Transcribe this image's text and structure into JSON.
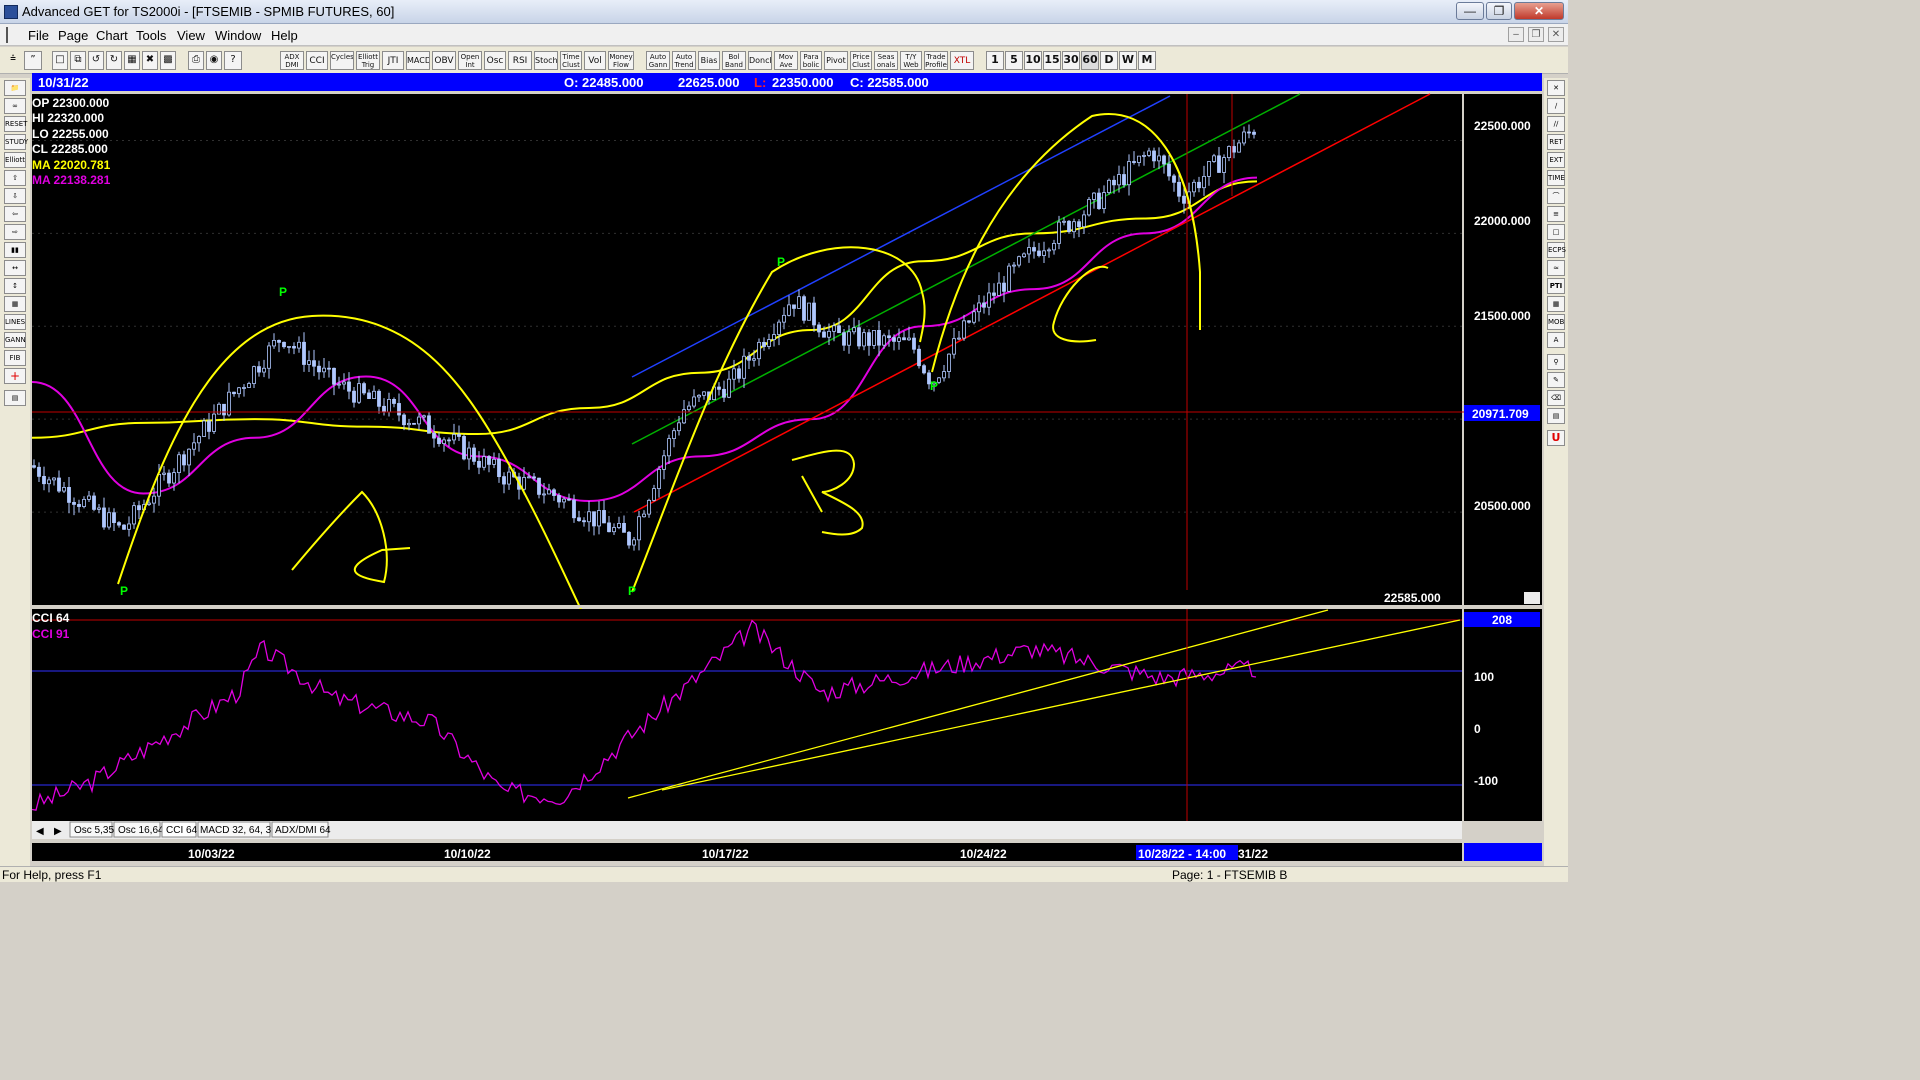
{
  "window": {
    "title": "Advanced GET for TS2000i - [FTSEMIB - SPMIB FUTURES, 60]"
  },
  "menu": [
    "File",
    "Page",
    "Chart",
    "Tools",
    "View",
    "Window",
    "Help"
  ],
  "toolbar": {
    "studies": [
      "ADX DMI",
      "CCI",
      "Cycles",
      "Elliott Trig",
      "JTI",
      "MACD",
      "OBV",
      "Open Int",
      "Osc",
      "RSI",
      "Stoch",
      "Time Clust",
      "Vol",
      "Money Flow",
      "Auto Gann",
      "Auto Trend",
      "Bias",
      "Bol Band",
      "Donch",
      "Mov Ave",
      "Para bolic",
      "Pivot",
      "Price Clust",
      "Seas onals",
      "T/Y Web",
      "Trade Profile",
      "XTL"
    ],
    "timeframes": [
      "1",
      "5",
      "10",
      "15",
      "30",
      "60",
      "D",
      "W",
      "M"
    ]
  },
  "header": {
    "date": "10/31/22",
    "open": "O: 22485.000",
    "high": "22625.000",
    "low_label": "L:",
    "low": "22350.000",
    "close": "C: 22585.000"
  },
  "readout": {
    "op": "OP  22300.000",
    "hi": "HI   22320.000",
    "lo": "LO  22255.000",
    "cl": "CL  22285.000",
    "ma1": "MA  22020.781",
    "ma2": "MA  22138.281"
  },
  "colors": {
    "bg": "#000000",
    "candle": "#b0c8ff",
    "ma1": "#ffff00",
    "ma2": "#e000e0",
    "green": "#00ff00",
    "blue": "#2040ff",
    "red": "#ff0000",
    "header_bg": "#0000ff",
    "cci": "#e000e0",
    "annot": "#ffff00"
  },
  "price_axis": {
    "ticks": [
      "22500.000",
      "22000.000",
      "21500.000",
      "20500.000"
    ],
    "cursor_label": "20971.709",
    "last_price": "22585.000"
  },
  "pivots": [
    "P",
    "P",
    "P",
    "P",
    "P"
  ],
  "annotations": {
    "a": "A",
    "b": "B",
    "c": "C"
  },
  "cci": {
    "label1": "CCI 64",
    "label2": "CCI  91",
    "ticks": [
      "100",
      "0",
      "-100"
    ],
    "value_label": "208"
  },
  "tabs": [
    "Osc 5,35",
    "Osc 16,64",
    "CCI 64",
    "MACD 32, 64, 32",
    "ADX/DMI 64"
  ],
  "time_axis": {
    "labels": [
      "10/03/22",
      "10/10/22",
      "10/17/22",
      "10/24/22"
    ],
    "cursor_label": "10/28/22 - 14:00",
    "trailing": "31/22"
  },
  "status": {
    "left": "For Help, press F1",
    "right": "Page: 1 - FTSEMIB B"
  },
  "chart_data": {
    "type": "candlestick",
    "x_labels": [
      "10/03/22",
      "10/10/22",
      "10/17/22",
      "10/24/22"
    ],
    "ylim": [
      20000,
      22750
    ],
    "y_ticks": [
      20500,
      21000,
      21500,
      22000,
      22500
    ],
    "series": [
      {
        "name": "MA",
        "values": [
          20900,
          20980,
          21000,
          20960,
          20920,
          21060,
          21250,
          21480,
          21850,
          22000,
          22080,
          22280
        ]
      },
      {
        "name": "MA",
        "values": [
          21200,
          20600,
          20900,
          21230,
          20800,
          20560,
          20800,
          21000,
          21500,
          21700,
          22000,
          22300
        ]
      }
    ],
    "cci": {
      "ylim": [
        -200,
        230
      ],
      "values": [
        -170,
        -120,
        60,
        150,
        50,
        0,
        -140,
        -150,
        190,
        60,
        150,
        90,
        110
      ]
    }
  }
}
